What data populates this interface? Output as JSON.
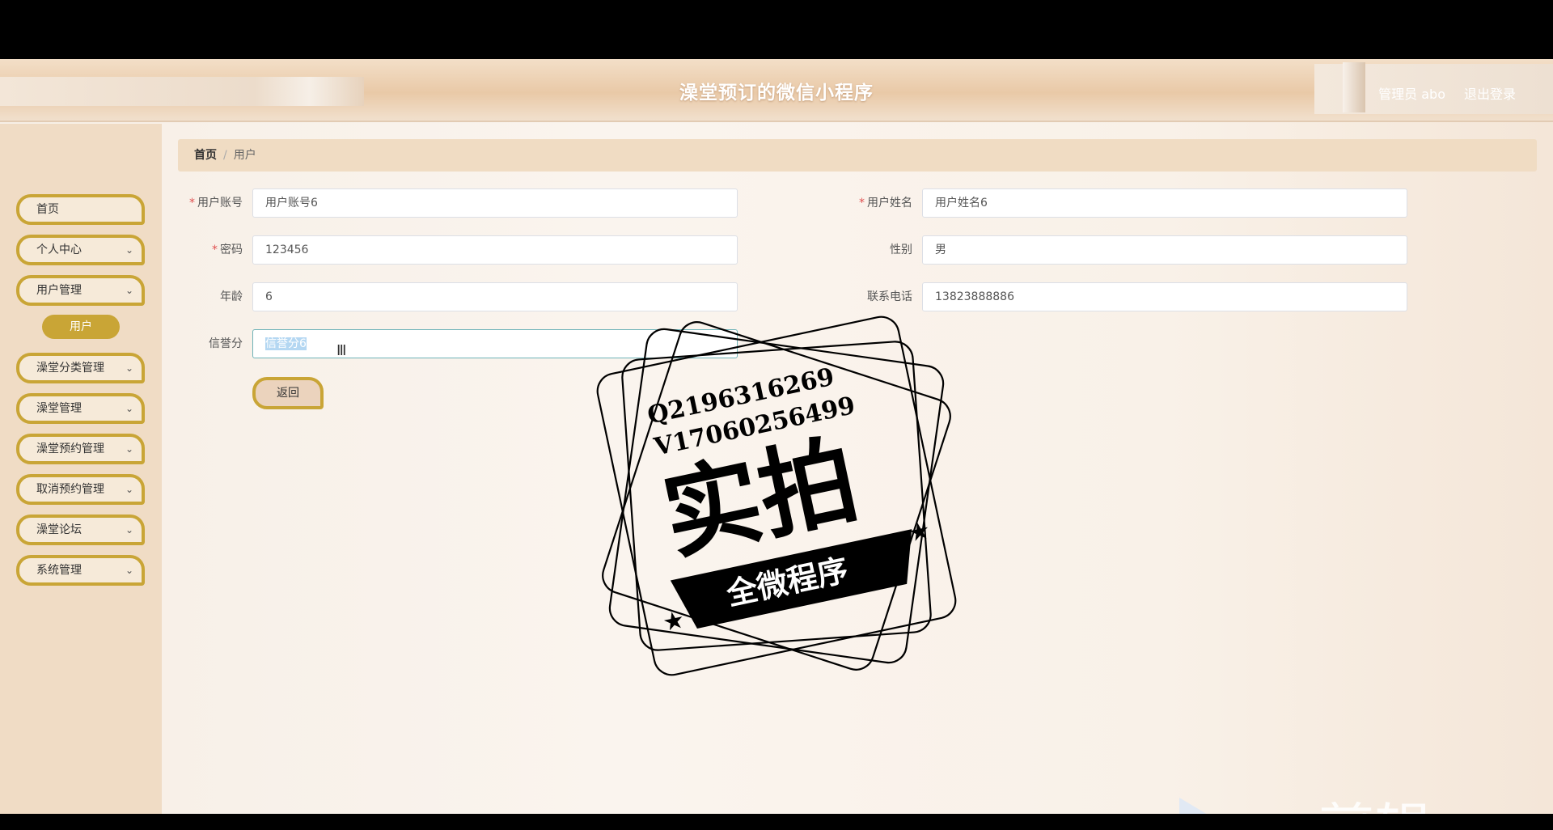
{
  "header": {
    "title": "澡堂预订的微信小程序",
    "user": "管理员 abo",
    "logout": "退出登录"
  },
  "sidebar": {
    "items": [
      {
        "label": "首页",
        "has_chevron": false
      },
      {
        "label": "个人中心",
        "has_chevron": true
      },
      {
        "label": "用户管理",
        "has_chevron": true
      },
      {
        "label": "澡堂分类管理",
        "has_chevron": true
      },
      {
        "label": "澡堂管理",
        "has_chevron": true
      },
      {
        "label": "澡堂预约管理",
        "has_chevron": true
      },
      {
        "label": "取消预约管理",
        "has_chevron": true
      },
      {
        "label": "澡堂论坛",
        "has_chevron": true
      },
      {
        "label": "系统管理",
        "has_chevron": true
      }
    ],
    "sub_item": "用户",
    "chevron_icon": "chevron-down-icon"
  },
  "breadcrumb": {
    "home": "首页",
    "sep": "/",
    "current": "用户"
  },
  "form": {
    "account_label": "用户账号",
    "account_value": "用户账号6",
    "name_label": "用户姓名",
    "name_value": "用户姓名6",
    "password_label": "密码",
    "password_value": "123456",
    "gender_label": "性别",
    "gender_value": "男",
    "age_label": "年龄",
    "age_value": "6",
    "phone_label": "联系电话",
    "phone_value": "13823888886",
    "credit_label": "信誉分",
    "credit_value": "信誉分6",
    "required_mark": "*",
    "back_button": "返回"
  },
  "overlay": {
    "stamp_line1": "Q2196316269",
    "stamp_line2": "V17060256499",
    "stamp_main": "实拍",
    "stamp_banner": "全微程序",
    "watermark": "ev剪辑"
  },
  "colors": {
    "accent_gold": "#c9a536",
    "header_bg": "#e9c9a7",
    "sidebar_bg": "#f0dcc5",
    "required_red": "#e05050"
  }
}
